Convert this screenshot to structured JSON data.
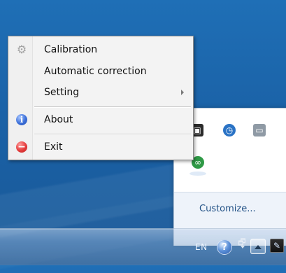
{
  "context_menu": {
    "items": [
      {
        "label": "Calibration",
        "icon": "gear-icon"
      },
      {
        "label": "Automatic correction"
      },
      {
        "label": "Setting",
        "has_submenu": true
      },
      {
        "label": "About",
        "icon": "info-icon"
      },
      {
        "label": "Exit",
        "icon": "minus-icon"
      }
    ]
  },
  "overflow_flyout": {
    "customize_label": "Customize..."
  },
  "taskbar": {
    "language": "EN",
    "icons": [
      "help-icon",
      "monitor-icon",
      "show-hidden-icons-button",
      "app-icon",
      "flag-icon"
    ]
  },
  "colors": {
    "desktop_blue": "#1b63a8",
    "menu_bg": "#f3f3f3",
    "flyout_bg": "#eef3fa",
    "link_blue": "#1f4f84"
  }
}
